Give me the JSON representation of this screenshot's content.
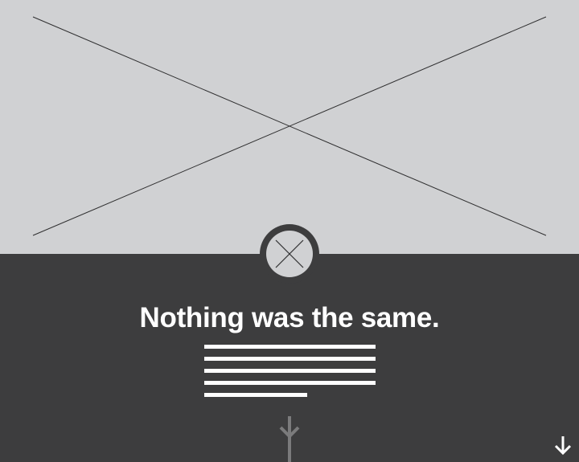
{
  "hero": {
    "placeholder_icon": "image-placeholder-x-icon"
  },
  "avatar": {
    "placeholder_icon": "avatar-placeholder-x-icon"
  },
  "content": {
    "headline": "Nothing was the same.",
    "body_placeholder_lines": 5
  },
  "scroll": {
    "indicator_icon": "arrow-down-icon",
    "corner_icon": "arrow-down-icon"
  },
  "colors": {
    "placeholder_bg": "#d0d1d3",
    "panel_bg": "#3d3d3e",
    "text": "#ffffff",
    "muted_arrow": "#7b7b7c"
  }
}
